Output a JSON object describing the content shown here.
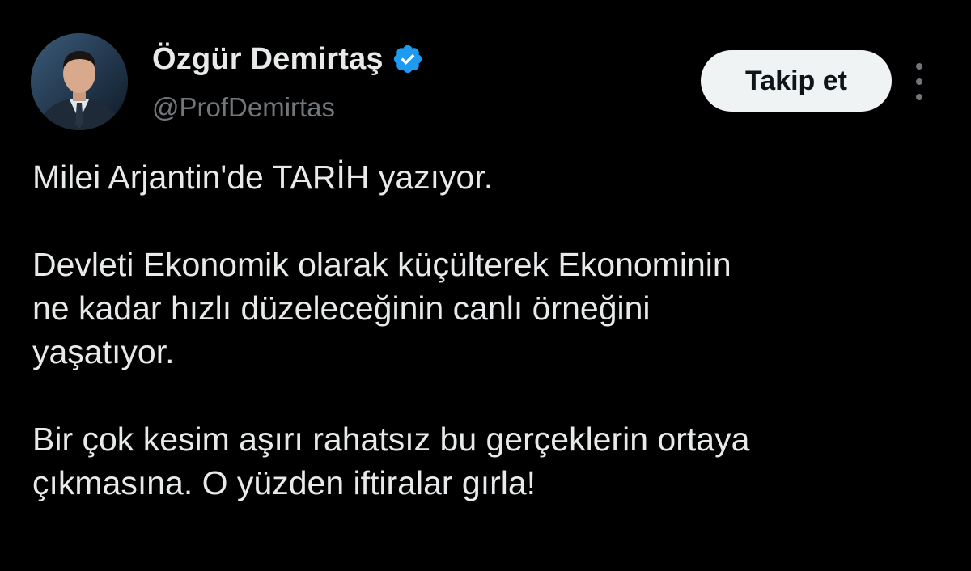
{
  "author": {
    "display_name": "Özgür Demirtaş",
    "handle": "@ProfDemirtas",
    "verified": true,
    "verified_color": "#1d9bf0"
  },
  "actions": {
    "follow_label": "Takip et",
    "more_icon": "more-vertical-icon"
  },
  "tweet": {
    "paragraphs": [
      [
        "Milei Arjantin'de TARİH yazıyor."
      ],
      [
        "Devleti Ekonomik olarak küçülterek Ekonominin",
        "ne kadar hızlı düzeleceğinin canlı örneğini",
        "yaşatıyor."
      ],
      [
        "Bir çok kesim aşırı rahatsız bu gerçeklerin ortaya",
        "çıkmasına. O yüzden iftiralar gırla!"
      ]
    ]
  },
  "colors": {
    "background": "#000000",
    "text_primary": "#e7e9ea",
    "text_secondary": "#71767b",
    "button_bg": "#eff3f4",
    "button_text": "#0f1419"
  }
}
